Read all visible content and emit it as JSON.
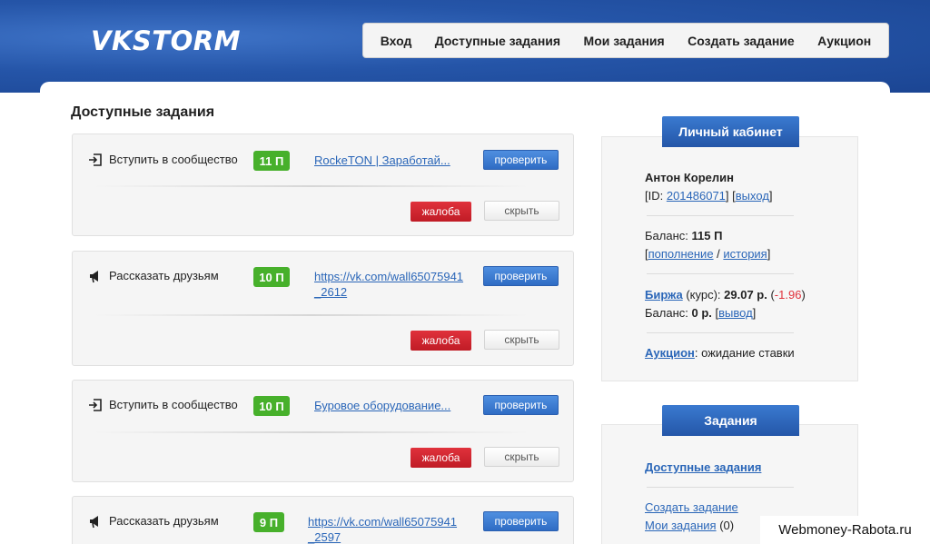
{
  "header": {
    "logo": "VKSTORM",
    "nav": [
      "Вход",
      "Доступные задания",
      "Мои задания",
      "Создать задание",
      "Аукцион"
    ]
  },
  "main": {
    "title": "Доступные задания",
    "tasks": [
      {
        "icon": "enter-icon",
        "type": "Вступить в сообщество",
        "reward": "11 П",
        "link": "RockeTON | Заработай...",
        "check": "проверить",
        "complain": "жалоба",
        "hide": "скрыть"
      },
      {
        "icon": "megaphone-icon",
        "type": "Рассказать друзьям",
        "reward": "10 П",
        "link": "https://vk.com/wall65075941_2612",
        "check": "проверить",
        "complain": "жалоба",
        "hide": "скрыть"
      },
      {
        "icon": "enter-icon",
        "type": "Вступить в сообщество",
        "reward": "10 П",
        "link": "Буровое оборудование...",
        "check": "проверить",
        "complain": "жалоба",
        "hide": "скрыть"
      },
      {
        "icon": "megaphone-icon",
        "type": "Рассказать друзьям",
        "reward": "9 П",
        "link": "https://vk.com/wall65075941_2597",
        "check": "проверить"
      }
    ]
  },
  "sidebar": {
    "cabinet": {
      "title": "Личный кабинет",
      "name": "Антон Корелин",
      "id_prefix": "[ID: ",
      "id": "201486071",
      "id_mid": "] [",
      "logout": "выход",
      "id_suffix": "]",
      "balance_label": "Баланс: ",
      "balance": "115 П",
      "bracket_open": "[",
      "topup": "пополнение",
      "slash": " / ",
      "history": "история",
      "bracket_close": "]",
      "exchange": "Биржа",
      "rate_label": " (курс): ",
      "rate": "29.07 р.",
      "change_open": " (",
      "change": "-1.96",
      "change_close": ")",
      "balance2_label": "Баланс: ",
      "balance2": "0 р.",
      "withdraw_open": " [",
      "withdraw": "вывод",
      "withdraw_close": "]",
      "auction": "Аукцион",
      "auction_status": ": ожидание ставки"
    },
    "tasks": {
      "title": "Задания",
      "available": "Доступные задания",
      "create": "Создать задание",
      "mine": "Мои задания",
      "mine_count": " (0)"
    }
  },
  "watermark": "Webmoney-Rabota.ru"
}
